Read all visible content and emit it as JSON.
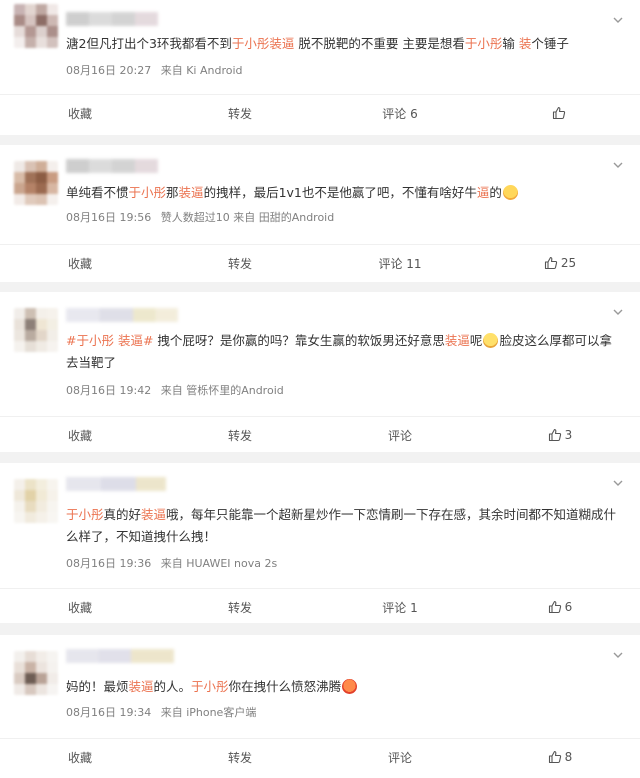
{
  "colors": {
    "highlight": "#eb7350",
    "meta": "#808080",
    "bg": "#f2f2f2"
  },
  "posts": [
    {
      "content": [
        {
          "t": "溏2但凡打出个3环我都看不到"
        },
        {
          "t": "于小彤装逼",
          "hl": true
        },
        {
          "t": " 脱不脱靶的不重要 主要是想看"
        },
        {
          "t": "于小彤",
          "hl": true
        },
        {
          "t": "输 "
        },
        {
          "t": "装",
          "hl": true
        },
        {
          "t": "个锤子"
        }
      ],
      "date": "08月16日 20:27",
      "source": "来自 Ki Android",
      "actions": {
        "fav": "收藏",
        "repost": "转发",
        "comment": "评论 6",
        "like": ""
      }
    },
    {
      "content": [
        {
          "t": "单纯看不惯"
        },
        {
          "t": "于小彤",
          "hl": true
        },
        {
          "t": "那"
        },
        {
          "t": "装逼",
          "hl": true
        },
        {
          "t": "的拽样，最后1v1也不是他赢了吧，不懂有啥好牛"
        },
        {
          "t": "逼",
          "hl": true
        },
        {
          "t": "的"
        },
        {
          "emoji": "drool-emoji"
        }
      ],
      "date": "08月16日 19:56",
      "source": "赞人数超过10  来自 田甜的Android",
      "actions": {
        "fav": "收藏",
        "repost": "转发",
        "comment": "评论 11",
        "like": "25"
      }
    },
    {
      "content": [
        {
          "t": "#于小彤 装逼#",
          "hl": true
        },
        {
          "t": " 拽个屁呀？是你赢的吗？靠女生赢的软饭男还好意思"
        },
        {
          "t": "装逼",
          "hl": true
        },
        {
          "t": "呢"
        },
        {
          "emoji": "shocked-emoji"
        },
        {
          "t": "脸皮这么厚都可以拿去当靶了"
        }
      ],
      "date": "08月16日 19:42",
      "source": "来自 管栎怀里的Android",
      "actions": {
        "fav": "收藏",
        "repost": "转发",
        "comment": "评论",
        "like": "3"
      }
    },
    {
      "content": [
        {
          "t": "于小彤",
          "hl": true
        },
        {
          "t": "真的好"
        },
        {
          "t": "装逼",
          "hl": true
        },
        {
          "t": "哦，每年只能靠一个超新星炒作一下恋情刷一下存在感，其余时间都不知道糊成什么样了，不知道拽什么拽！"
        }
      ],
      "date": "08月16日 19:36",
      "source": "来自 HUAWEI nova 2s",
      "actions": {
        "fav": "收藏",
        "repost": "转发",
        "comment": "评论 1",
        "like": "6"
      }
    },
    {
      "content": [
        {
          "t": "妈的！最烦"
        },
        {
          "t": "装逼",
          "hl": true
        },
        {
          "t": "的人。"
        },
        {
          "t": "于小彤",
          "hl": true
        },
        {
          "t": "你在拽什么愤怒沸腾"
        },
        {
          "emoji": "angry-emoji"
        }
      ],
      "date": "08月16日 19:34",
      "source": "来自 iPhone客户端",
      "actions": {
        "fav": "收藏",
        "repost": "转发",
        "comment": "评论",
        "like": "8"
      }
    }
  ]
}
